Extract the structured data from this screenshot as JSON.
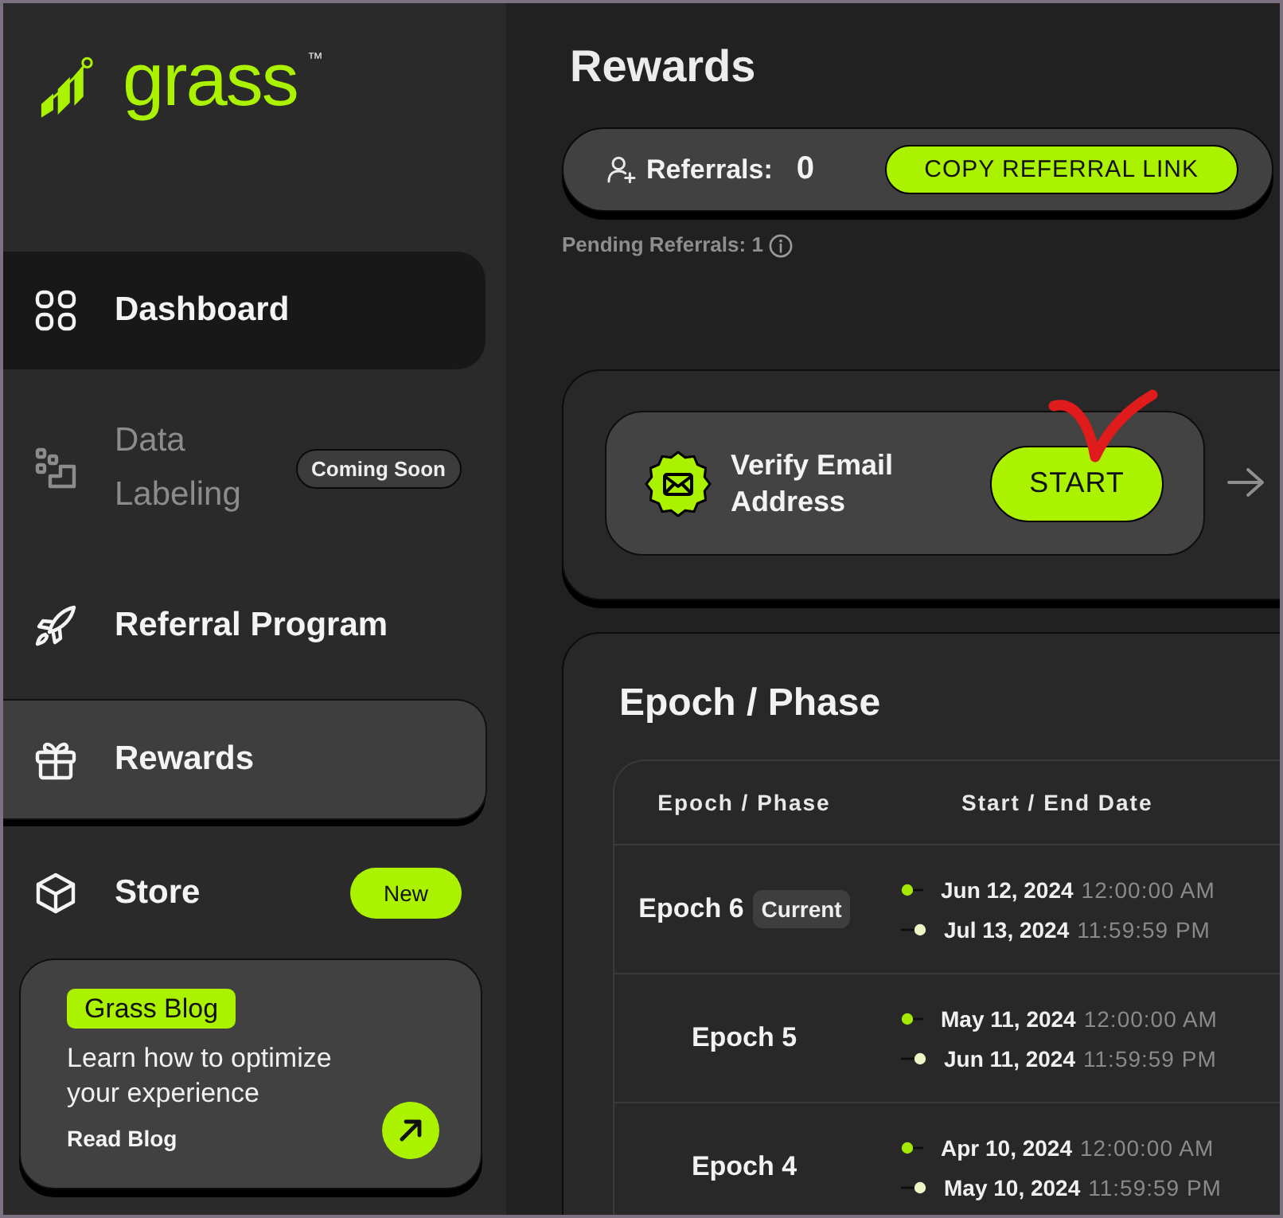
{
  "logo": {
    "wordmark": "grass",
    "trademark": "™"
  },
  "sidebar": {
    "items": [
      {
        "label": "Dashboard",
        "selected": false,
        "hovered": true,
        "disabled": false
      },
      {
        "label": "Data Labeling",
        "selected": false,
        "hovered": false,
        "disabled": true,
        "badge": {
          "text": "Coming Soon",
          "kind": "muted"
        }
      },
      {
        "label": "Referral Program",
        "selected": false,
        "hovered": false,
        "disabled": false
      },
      {
        "label": "Rewards",
        "selected": true,
        "hovered": false,
        "disabled": false
      },
      {
        "label": "Store",
        "selected": false,
        "hovered": false,
        "disabled": false,
        "badge": {
          "text": "New",
          "kind": "accent"
        }
      }
    ]
  },
  "blog_card": {
    "tag": "Grass Blog",
    "text": "Learn how to optimize your experience",
    "link": "Read Blog"
  },
  "page_title": "Rewards",
  "referrals": {
    "label": "Referrals:",
    "count": "0",
    "button": "COPY REFERRAL LINK",
    "pending": "Pending Referrals: **1**"
  },
  "tasks": [
    {
      "title": "Verify Email Address",
      "button": "START"
    }
  ],
  "annotation": {
    "kind": "checkmark"
  },
  "epochs": {
    "title": "Epoch / Phase",
    "columns": [
      "Epoch / Phase",
      "Start / End Date"
    ],
    "rows": [
      {
        "name": "Epoch 6",
        "badge": "Current",
        "start_date": "Jun 12, 2024",
        "start_time": "12:00:00 AM",
        "end_date": "Jul 13, 2024",
        "end_time": "11:59:59 PM"
      },
      {
        "name": "Epoch 5",
        "start_date": "May 11, 2024",
        "start_time": "12:00:00 AM",
        "end_date": "Jun 11, 2024",
        "end_time": "11:59:59 PM"
      },
      {
        "name": "Epoch 4",
        "start_date": "Apr 10, 2024",
        "start_time": "12:00:00 AM",
        "end_date": "May 10, 2024",
        "end_time": "11:59:59 PM"
      }
    ]
  }
}
